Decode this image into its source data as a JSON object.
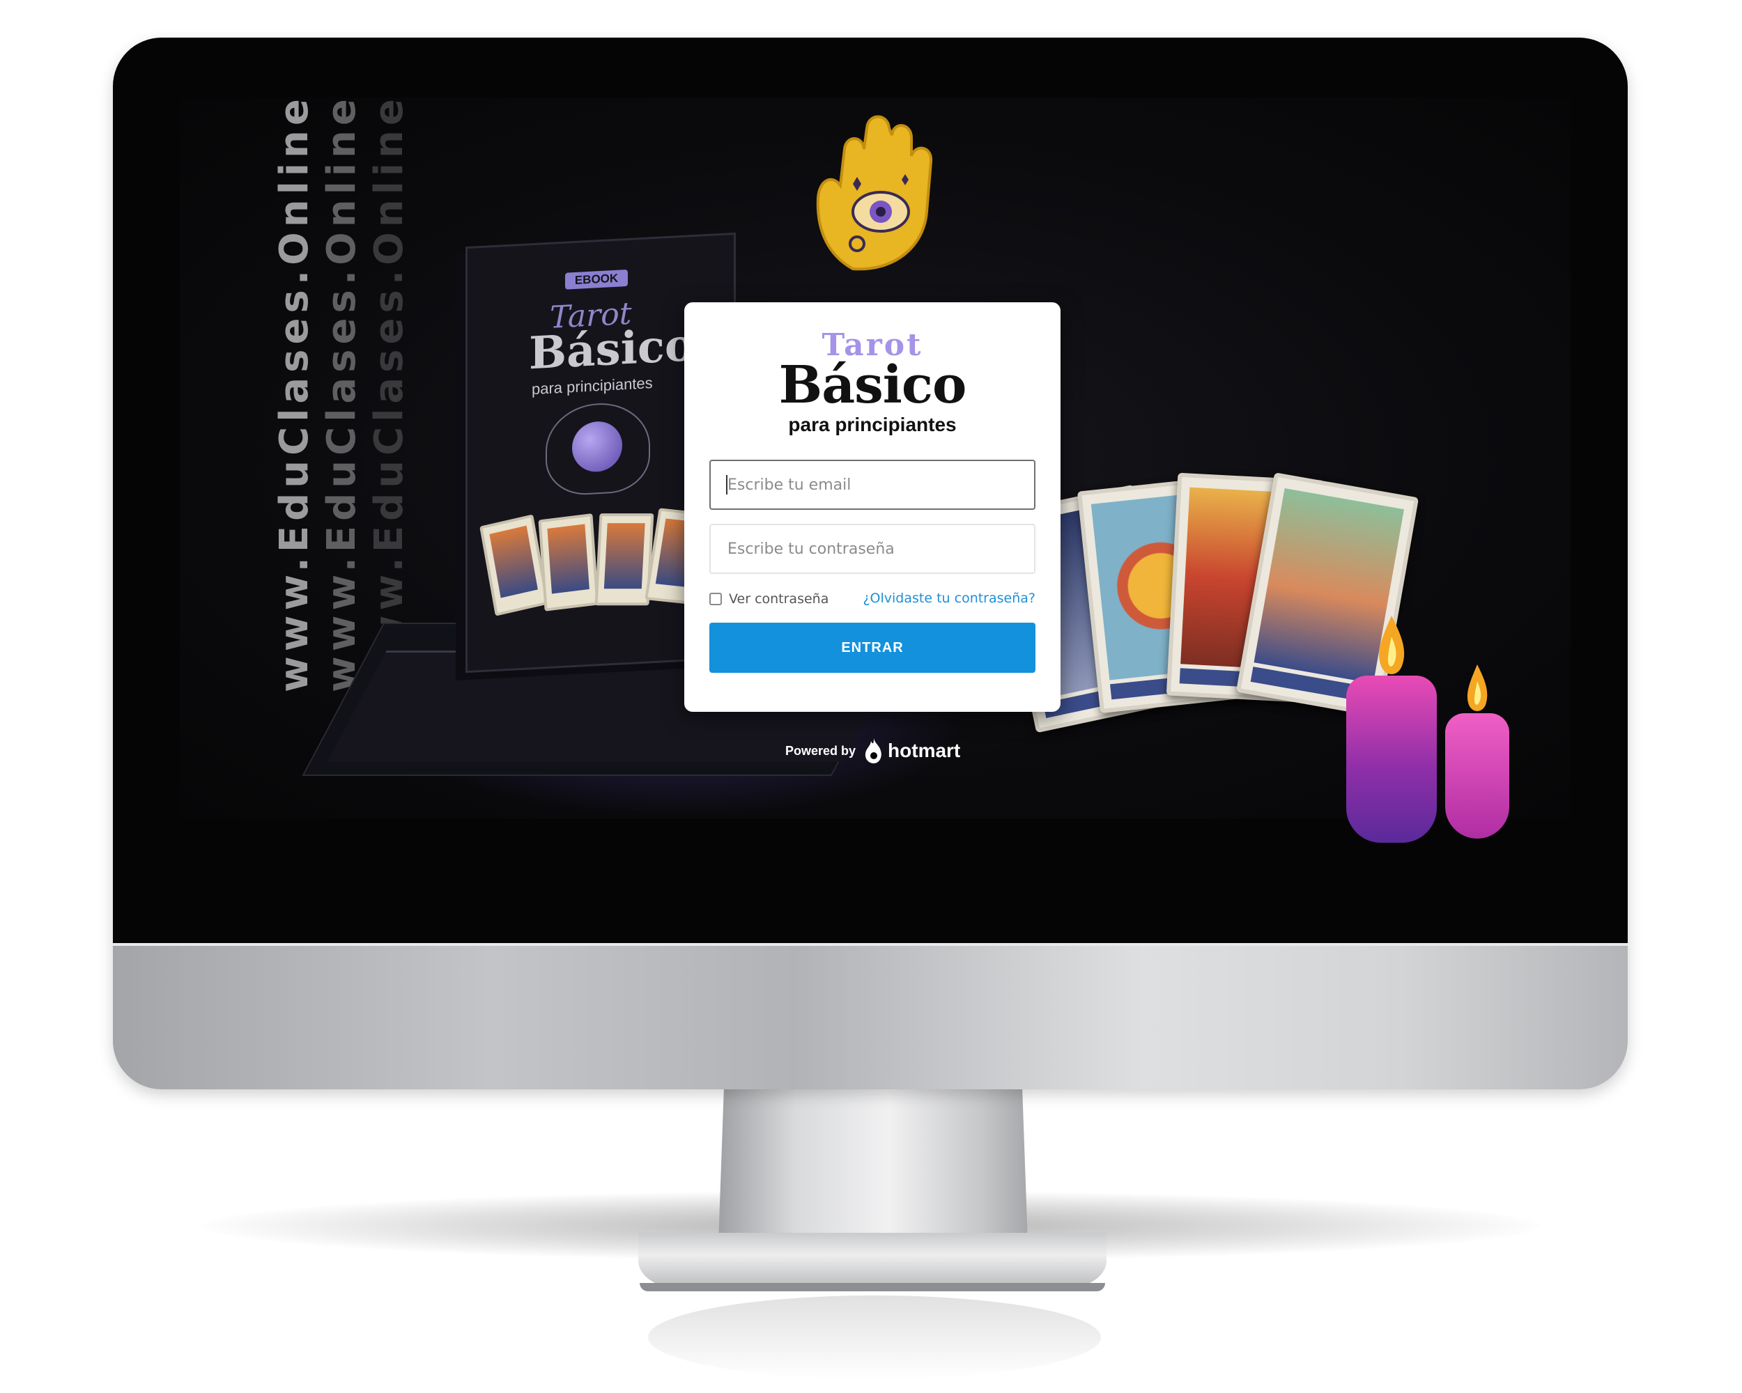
{
  "watermark": {
    "text": "www.EduClases.Online"
  },
  "ebook": {
    "badge": "EBOOK",
    "title_top": "Tarot",
    "title_main": "Básico",
    "title_sub": "para principiantes"
  },
  "login": {
    "logo_top": "Tarot",
    "logo_main": "Básico",
    "logo_sub": "para principiantes",
    "email_placeholder": "Escribe tu email",
    "password_placeholder": "Escribe tu contraseña",
    "show_password_label": "Ver contraseña",
    "forgot_password_link": "¿Olvidaste tu contraseña?",
    "submit_label": "ENTRAR"
  },
  "footer": {
    "powered_by": "Powered by",
    "brand": "hotmart"
  },
  "colors": {
    "accent_button": "#1391dc",
    "link": "#1e90d6",
    "logo_purple": "#a493e8",
    "screen_background": "#050506"
  },
  "icons": {
    "brand_icon": "hotmart-flame-icon",
    "decoration_hand": "hamsa-hand-icon"
  }
}
